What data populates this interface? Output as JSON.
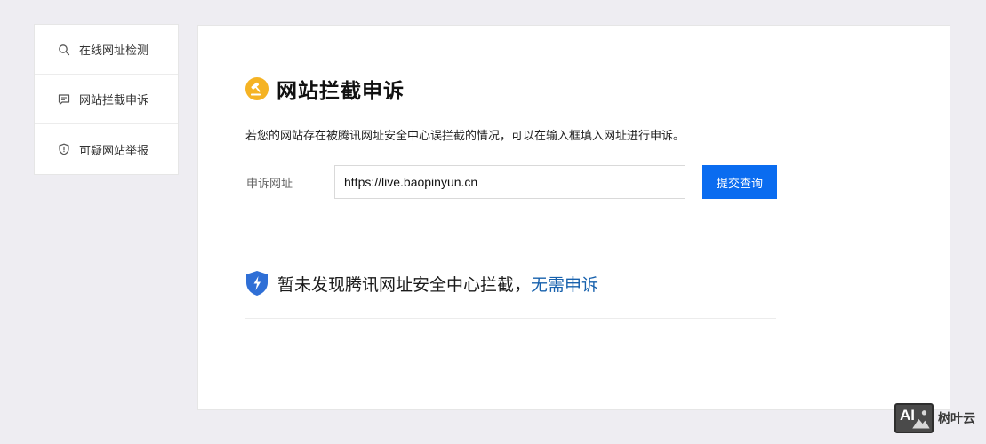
{
  "sidebar": {
    "items": [
      {
        "label": "在线网址检测",
        "icon": "search-icon"
      },
      {
        "label": "网站拦截申诉",
        "icon": "message-icon"
      },
      {
        "label": "可疑网站举报",
        "icon": "shield-alert-icon"
      }
    ]
  },
  "main": {
    "title": "网站拦截申诉",
    "description": "若您的网站存在被腾讯网址安全中心误拦截的情况，可以在输入框填入网址进行申诉。",
    "form": {
      "label": "申诉网址",
      "url_value": "https://live.baopinyun.cn",
      "submit_label": "提交查询"
    },
    "result": {
      "text": "暂未发现腾讯网址安全中心拦截，",
      "link": "无需申诉"
    }
  },
  "watermark": {
    "logo_text": "AI",
    "name": "树叶云"
  },
  "colors": {
    "primary": "#0a6cf0",
    "link": "#1761ad",
    "title_icon": "#f5b324",
    "shield": "#2f6fd6"
  }
}
